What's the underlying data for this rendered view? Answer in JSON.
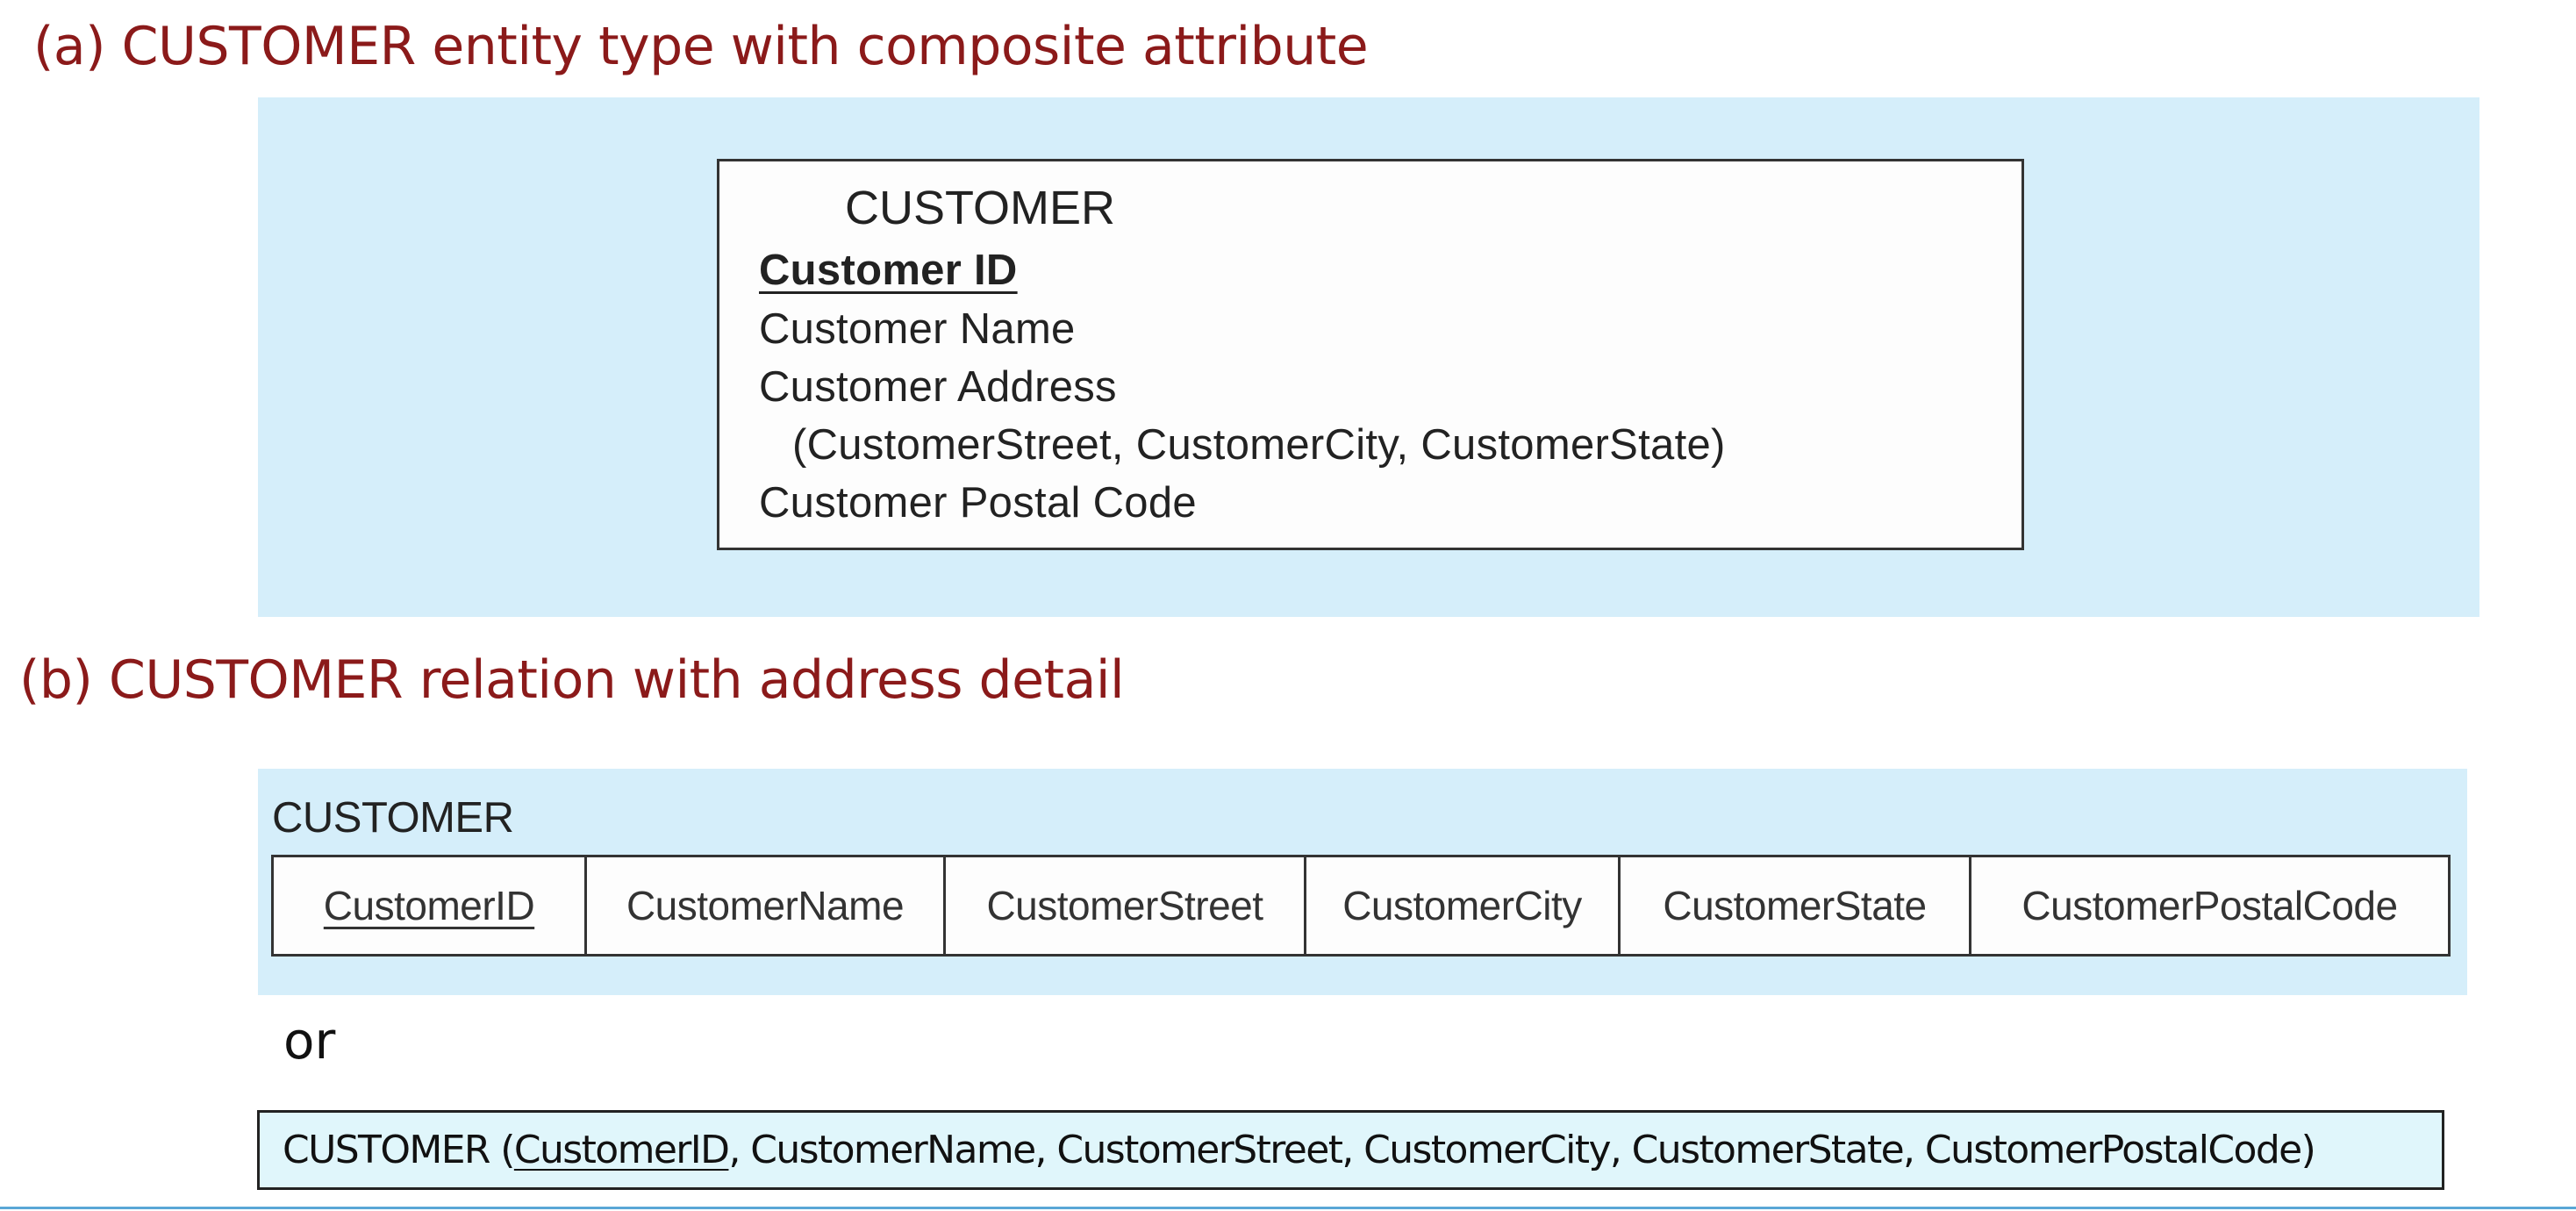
{
  "headings": {
    "a": "(a) CUSTOMER entity type with composite attribute",
    "b": "(b) CUSTOMER relation with address detail"
  },
  "entity": {
    "title": "CUSTOMER",
    "identifier": "Customer ID",
    "attributes": {
      "name": "Customer Name",
      "address": "Customer Address",
      "address_detail": "(CustomerStreet, CustomerCity, CustomerState)",
      "postal": "Customer Postal Code"
    }
  },
  "relation": {
    "title": "CUSTOMER",
    "columns": [
      "CustomerID",
      "CustomerName",
      "CustomerStreet",
      "CustomerCity",
      "CustomerState",
      "CustomerPostalCode"
    ]
  },
  "or_text": "or",
  "schema": {
    "prefix": "CUSTOMER (",
    "key": "CustomerID",
    "rest": ", CustomerName, CustomerStreet, CustomerCity, CustomerState, CustomerPostalCode)"
  },
  "colors": {
    "heading": "#8b1a1a",
    "panel": "#d5eefa",
    "schema_box": "#e0f6fb",
    "rule": "#5aa7d6"
  }
}
